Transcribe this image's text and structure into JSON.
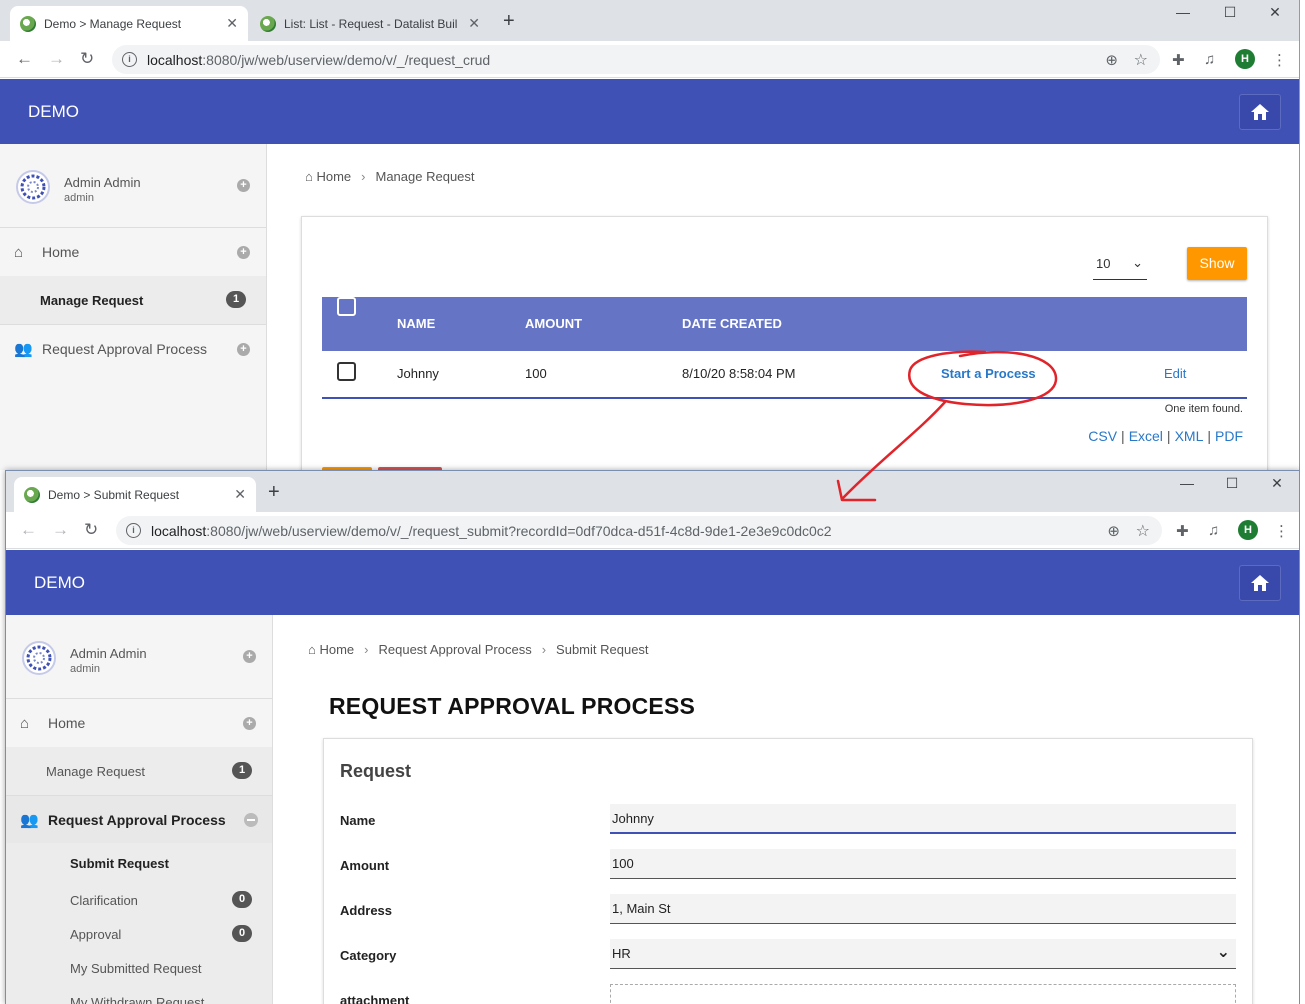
{
  "window1": {
    "tabs": [
      {
        "title": "Demo > Manage Request"
      },
      {
        "title": "List: List - Request - Datalist Buil"
      }
    ],
    "url_host": "localhost",
    "url_path": ":8080/jw/web/userview/demo/v/_/request_crud",
    "brand": "DEMO",
    "user": {
      "name": "Admin Admin",
      "username": "admin"
    },
    "menu": {
      "home": "Home",
      "manage_request": "Manage Request",
      "manage_request_count": "1",
      "request_approval": "Request Approval Process"
    },
    "breadcrumb": {
      "home": "Home",
      "current": "Manage Request"
    },
    "pager": {
      "value": "10",
      "show": "Show"
    },
    "table": {
      "headers": {
        "name": "NAME",
        "amount": "AMOUNT",
        "date": "DATE CREATED"
      },
      "rows": [
        {
          "name": "Johnny",
          "amount": "100",
          "date": "8/10/20 8:58:04 PM",
          "action": "Start a Process",
          "edit": "Edit"
        }
      ],
      "found": "One item found."
    },
    "export": {
      "csv": "CSV",
      "excel": "Excel",
      "xml": "XML",
      "pdf": "PDF"
    }
  },
  "window2": {
    "tab": {
      "title": "Demo > Submit Request"
    },
    "url_host": "localhost",
    "url_path": ":8080/jw/web/userview/demo/v/_/request_submit?recordId=0df70dca-d51f-4c8d-9de1-2e3e9c0dc0c2",
    "brand": "DEMO",
    "user": {
      "name": "Admin Admin",
      "username": "admin"
    },
    "menu": {
      "home": "Home",
      "manage_request": "Manage Request",
      "manage_request_count": "1",
      "request_approval": "Request Approval Process",
      "submit_request": "Submit Request",
      "clarification": "Clarification",
      "clarification_count": "0",
      "approval": "Approval",
      "approval_count": "0",
      "my_submitted": "My Submitted Request",
      "my_withdrawn": "My Withdrawn Request"
    },
    "breadcrumb": {
      "home": "Home",
      "mid": "Request Approval Process",
      "current": "Submit Request"
    },
    "page_title": "REQUEST APPROVAL PROCESS",
    "form": {
      "section": "Request",
      "fields": [
        {
          "label": "Name",
          "value": "Johnny"
        },
        {
          "label": "Amount",
          "value": "100"
        },
        {
          "label": "Address",
          "value": "1, Main St"
        },
        {
          "label": "Category",
          "value": "HR"
        },
        {
          "label": "attachment",
          "value": ""
        }
      ]
    }
  },
  "colors": {
    "appbar": "#3f51b5",
    "table_header": "#6574c4",
    "show_button": "#ff9800",
    "link": "#2878c8",
    "annotation": "#e0242a"
  },
  "icons": [
    "info-icon",
    "star-icon",
    "zoom-icon",
    "extensions-icon",
    "media-icon",
    "home-icon",
    "users-icon",
    "chevron-down-icon"
  ]
}
